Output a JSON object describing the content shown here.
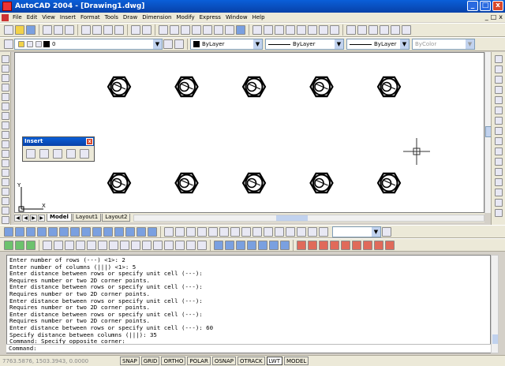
{
  "window": {
    "title": "AutoCAD 2004 - [Drawing1.dwg]",
    "min": "_",
    "max": "□",
    "close": "x"
  },
  "menu": {
    "items": [
      "File",
      "Edit",
      "View",
      "Insert",
      "Format",
      "Tools",
      "Draw",
      "Dimension",
      "Modify",
      "Express",
      "Window",
      "Help"
    ],
    "doc_min": "_",
    "doc_max": "□",
    "doc_close": "x"
  },
  "layer": {
    "value": "0"
  },
  "color": {
    "value": "ByLayer"
  },
  "linetype": {
    "value": "ByLayer"
  },
  "lineweight": {
    "value": "ByLayer"
  },
  "plotstyle": {
    "value": "ByColor"
  },
  "insert_panel": {
    "title": "Insert",
    "close": "x"
  },
  "ucs": {
    "x": "X",
    "y": "Y"
  },
  "tabs": {
    "model": "Model",
    "layout1": "Layout1",
    "layout2": "Layout2"
  },
  "command_history": [
    "Enter number of rows (---) <1>: 2",
    "Enter number of columns (|||) <1>: 5",
    "Enter distance between rows or specify unit cell (---):",
    "Requires number or two 2D corner points.",
    "Enter distance between rows or specify unit cell (---):",
    "Requires number or two 2D corner points.",
    "Enter distance between rows or specify unit cell (---):",
    "Requires number or two 2D corner points.",
    "Enter distance between rows or specify unit cell (---):",
    "Requires number or two 2D corner points.",
    "Enter distance between rows or specify unit cell (---): 60",
    "Specify distance between columns (|||): 35",
    "Command: Specify opposite corner:"
  ],
  "command_prompt": "Command:",
  "status": {
    "coords": "7763.5876, 1503.3943, 0.0000",
    "buttons": [
      "SNAP",
      "GRID",
      "ORTHO",
      "POLAR",
      "OSNAP",
      "OTRACK",
      "LWT",
      "MODEL"
    ]
  },
  "drawing": {
    "rows": 2,
    "columns": 5,
    "object": "hex-nut"
  }
}
